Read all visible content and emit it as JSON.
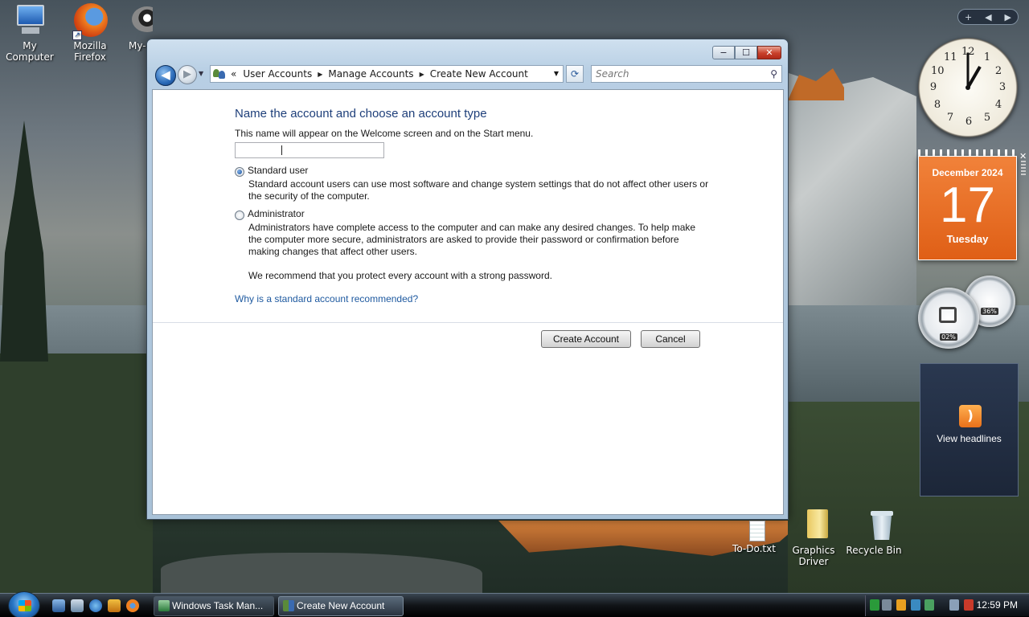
{
  "desktop": {
    "icons": [
      {
        "label": "My Computer"
      },
      {
        "label": "Mozilla Firefox"
      },
      {
        "label": "My-"
      },
      {
        "label": "To-Do.txt"
      },
      {
        "label": "Graphics Driver"
      },
      {
        "label": "Recycle Bin"
      }
    ]
  },
  "window": {
    "caption_buttons": {
      "minimize": "−",
      "maximize": "☐",
      "close": "✕"
    },
    "nav": {
      "back": "◀",
      "forward": "▶",
      "breadcrumb_overflow": "«",
      "breadcrumbs": [
        "User Accounts",
        "Manage Accounts",
        "Create New Account"
      ],
      "search_placeholder": "Search"
    },
    "heading": "Name the account and choose an account type",
    "name_hint": "This name will appear on the Welcome screen and on the Start menu.",
    "name_value": "",
    "options": {
      "standard": {
        "label": "Standard user",
        "selected": true,
        "description": "Standard account users can use most software and change system settings that do not affect other users or the security of the computer."
      },
      "admin": {
        "label": "Administrator",
        "selected": false,
        "description": "Administrators have complete access to the computer and can make any desired changes. To help make the computer more secure, administrators are asked to provide their password or confirmation before making changes that affect other users."
      }
    },
    "recommendation": "We recommend that you protect every account with a strong password.",
    "help_link": "Why is a standard account recommended?",
    "buttons": {
      "create": "Create Account",
      "cancel": "Cancel"
    }
  },
  "gadgets": {
    "sidebar_controls": {
      "add": "+",
      "prev": "◀",
      "next": "▶"
    },
    "clock": {
      "numbers": [
        "12",
        "1",
        "2",
        "3",
        "4",
        "5",
        "6",
        "7",
        "8",
        "9",
        "10",
        "11"
      ],
      "hour": 1,
      "minute": 0
    },
    "calendar": {
      "month_year": "December 2024",
      "day": "17",
      "weekday": "Tuesday"
    },
    "cpu_meter": {
      "cpu": "02%",
      "memory": "36%"
    },
    "feed": {
      "label": "View headlines"
    }
  },
  "taskbar": {
    "buttons": [
      {
        "label": "Windows Task Man...",
        "active": false
      },
      {
        "label": "Create New Account",
        "active": true
      }
    ],
    "time": "12:59 PM"
  },
  "colors": {
    "accent": "#1e3f7a",
    "link": "#1f5aa0",
    "calendar": "#e8691e"
  }
}
